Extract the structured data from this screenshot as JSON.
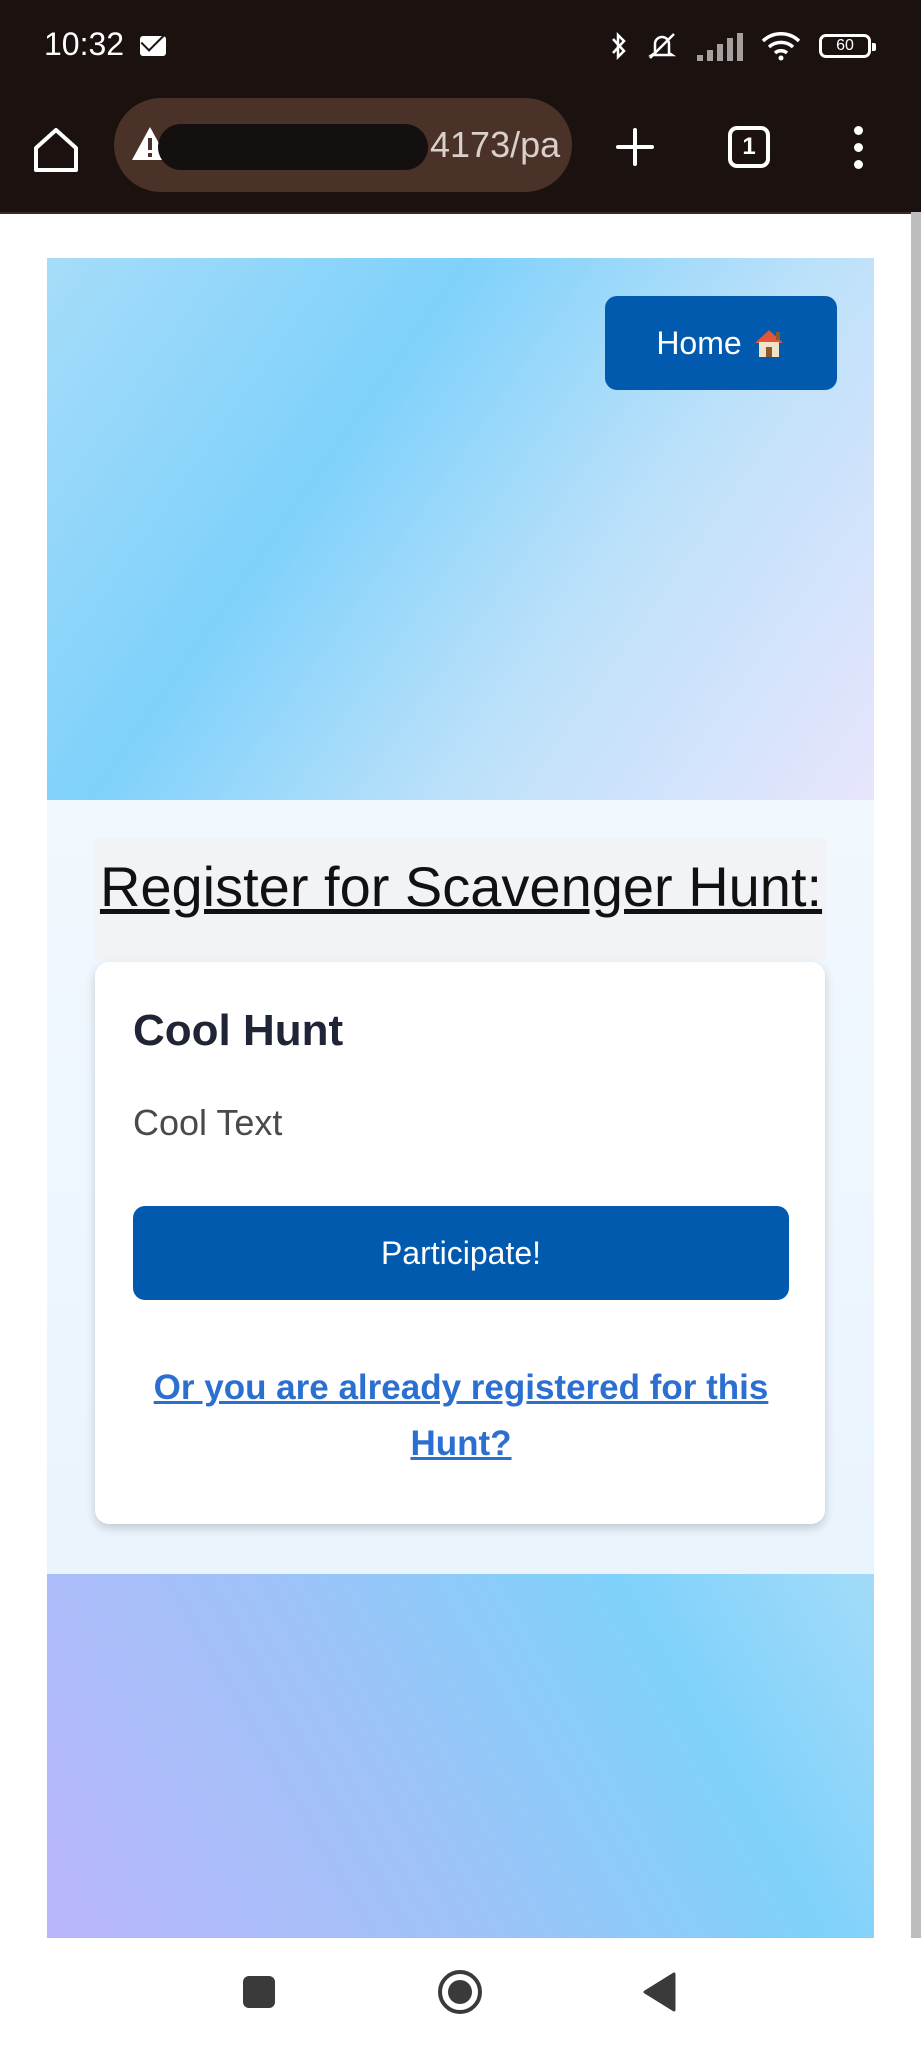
{
  "status_bar": {
    "time": "10:32",
    "battery": "60",
    "icons": [
      "mail-icon",
      "bluetooth-icon",
      "mute-icon",
      "signal-icon",
      "wifi-icon",
      "battery-icon"
    ]
  },
  "browser": {
    "url_visible": "4173/pa",
    "tab_count": "1",
    "icons": [
      "home-icon",
      "warning-icon",
      "plus-icon",
      "tabs-icon",
      "menu-icon"
    ]
  },
  "page": {
    "home_button_label": "Home",
    "home_button_icon": "house-icon",
    "register_title": "Register for Scavenger Hunt:",
    "card": {
      "title": "Cool Hunt",
      "text": "Cool Text",
      "participate_label": "Participate!",
      "already_registered_link": "Or you are already registered for this Hunt?"
    },
    "colors": {
      "primary_button": "#015aae",
      "link": "#2b6fd0"
    }
  },
  "nav_bar": {
    "icons": [
      "recent-apps-icon",
      "home-circle-icon",
      "back-icon"
    ]
  }
}
